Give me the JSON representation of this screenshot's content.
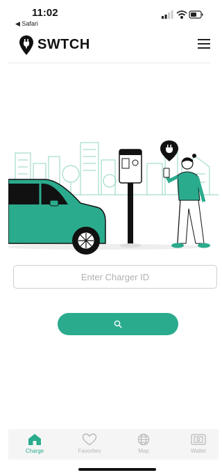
{
  "status_bar": {
    "time": "11:02",
    "back_label": "◀ Safari"
  },
  "header": {
    "brand": "SWTCH"
  },
  "charger": {
    "placeholder": "Enter Charger ID",
    "value": ""
  },
  "search": {
    "icon": "search-icon"
  },
  "nav": {
    "items": [
      {
        "label": "Charge",
        "icon": "home-icon",
        "active": true
      },
      {
        "label": "Favorites",
        "icon": "heart-icon",
        "active": false
      },
      {
        "label": "Map",
        "icon": "globe-icon",
        "active": false
      },
      {
        "label": "Wallet",
        "icon": "wallet-icon",
        "active": false
      }
    ]
  },
  "colors": {
    "accent": "#2bab8d",
    "text": "#111111",
    "muted": "#b8b8b8"
  }
}
